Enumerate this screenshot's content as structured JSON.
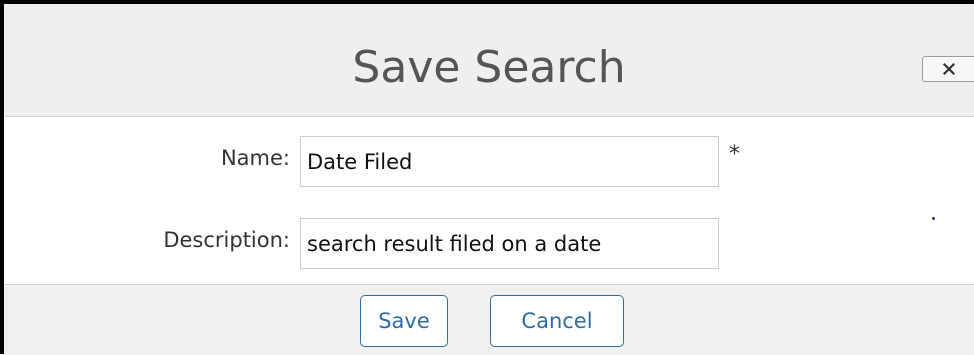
{
  "dialog": {
    "title": "Save Search",
    "close_icon": "close-x-icon"
  },
  "form": {
    "name": {
      "label": "Name:",
      "value": "Date Filed",
      "required_marker": "*"
    },
    "description": {
      "label": "Description:",
      "value": "search result filed on a date"
    }
  },
  "footer": {
    "save_label": "Save",
    "cancel_label": "Cancel"
  },
  "colors": {
    "header_bg": "#efefef",
    "footer_bg": "#f0f0f0",
    "button_accent": "#2e6da4",
    "title_text": "#555555"
  }
}
